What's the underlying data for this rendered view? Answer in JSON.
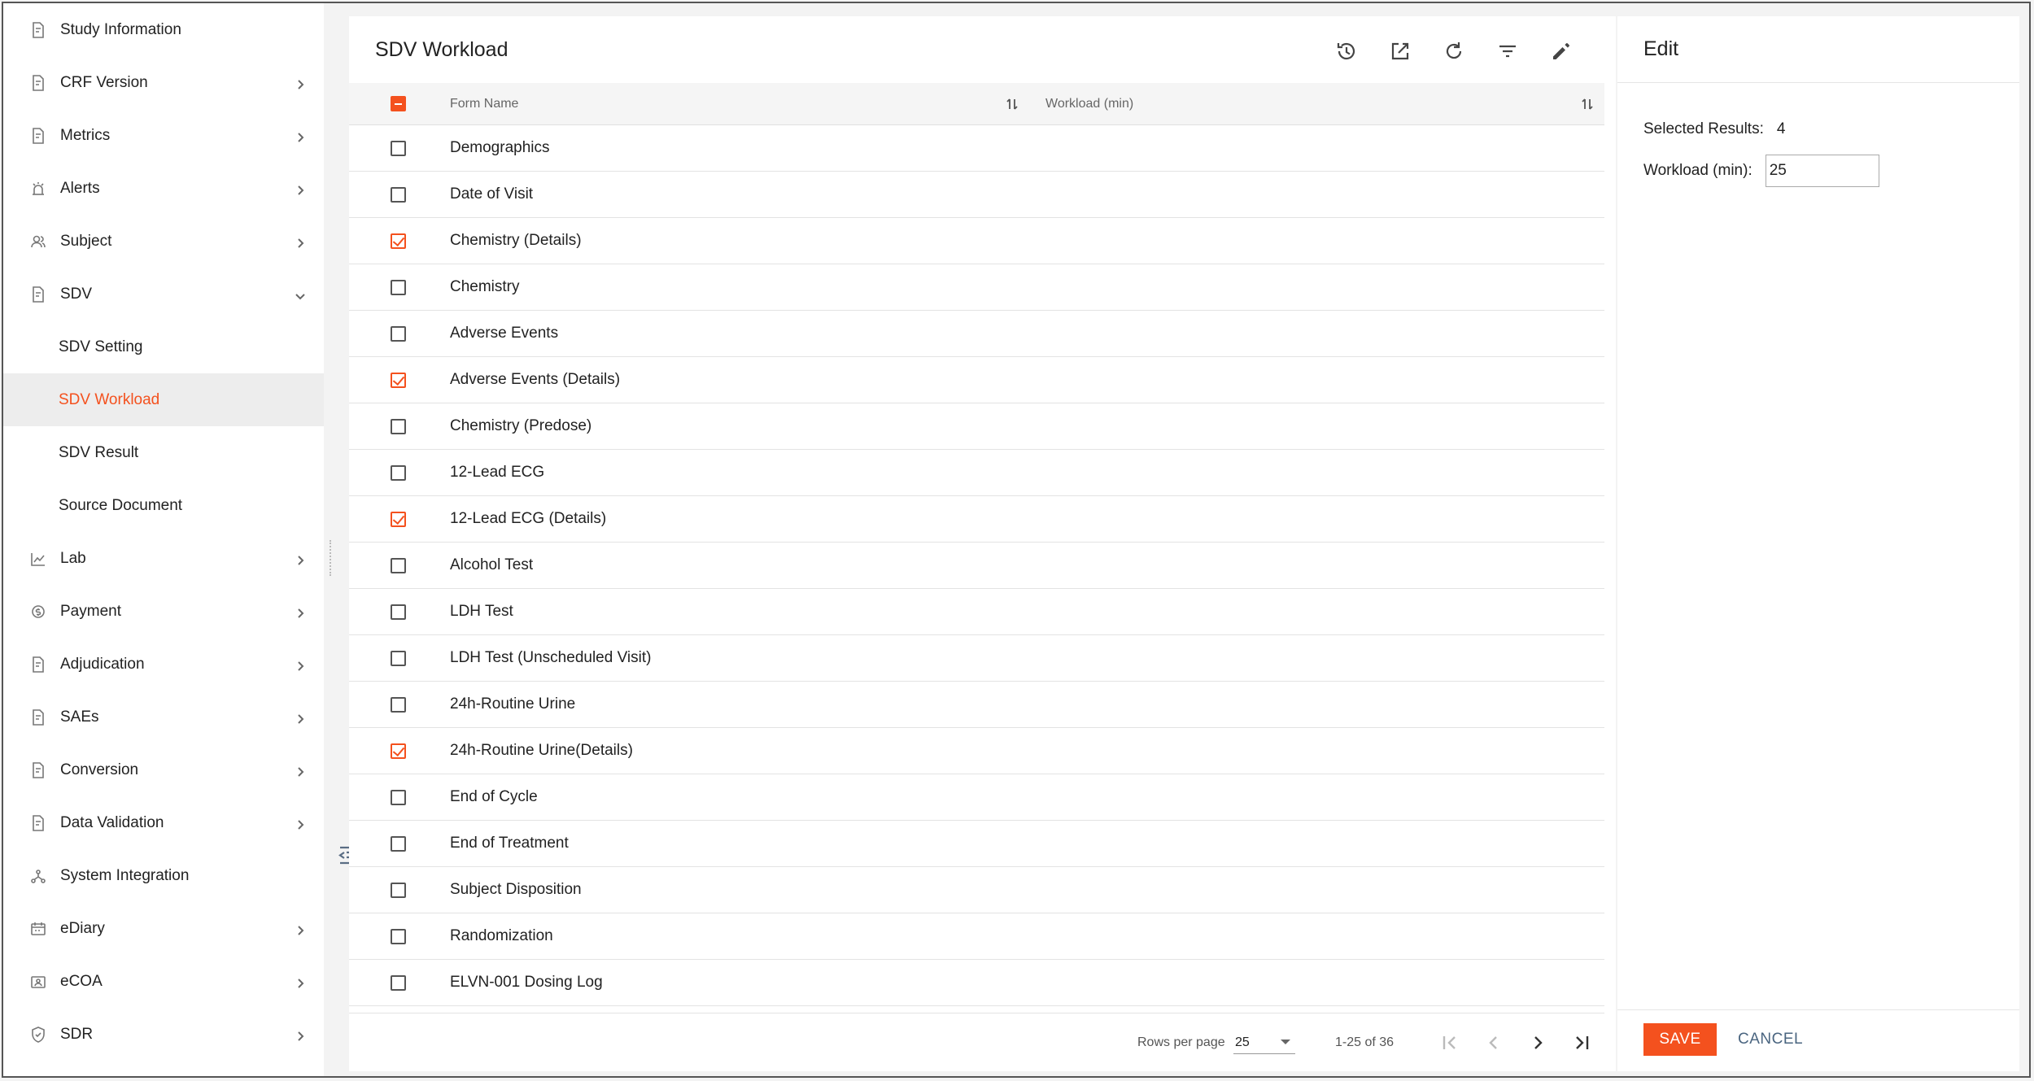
{
  "sidebar": {
    "items": [
      {
        "label": "Study Information",
        "icon": "document-icon",
        "chevron": "none"
      },
      {
        "label": "CRF Version",
        "icon": "document-icon",
        "chevron": "right"
      },
      {
        "label": "Metrics",
        "icon": "document-icon",
        "chevron": "right"
      },
      {
        "label": "Alerts",
        "icon": "alarm-icon",
        "chevron": "right"
      },
      {
        "label": "Subject",
        "icon": "people-icon",
        "chevron": "right"
      },
      {
        "label": "SDV",
        "icon": "document-icon",
        "chevron": "down"
      },
      {
        "label": "SDV Setting",
        "sub": true
      },
      {
        "label": "SDV Workload",
        "sub": true,
        "active": true
      },
      {
        "label": "SDV Result",
        "sub": true
      },
      {
        "label": "Source Document",
        "sub": true
      },
      {
        "label": "Lab",
        "icon": "line-chart-icon",
        "chevron": "right"
      },
      {
        "label": "Payment",
        "icon": "payment-icon",
        "chevron": "right"
      },
      {
        "label": "Adjudication",
        "icon": "document-icon",
        "chevron": "right"
      },
      {
        "label": "SAEs",
        "icon": "document-icon",
        "chevron": "right"
      },
      {
        "label": "Conversion",
        "icon": "document-icon",
        "chevron": "right"
      },
      {
        "label": "Data Validation",
        "icon": "document-icon",
        "chevron": "right"
      },
      {
        "label": "System Integration",
        "icon": "network-icon",
        "chevron": "none"
      },
      {
        "label": "eDiary",
        "icon": "calendar-icon",
        "chevron": "right"
      },
      {
        "label": "eCOA",
        "icon": "id-card-icon",
        "chevron": "right"
      },
      {
        "label": "SDR",
        "icon": "shield-icon",
        "chevron": "right"
      }
    ]
  },
  "main": {
    "title": "SDV Workload",
    "toolbar": [
      "history-icon",
      "open-external-icon",
      "refresh-icon",
      "filter-icon",
      "edit-pencil-icon"
    ],
    "columns": {
      "form_name": "Form Name",
      "workload": "Workload (min)"
    },
    "rows": [
      {
        "name": "Demographics",
        "checked": false
      },
      {
        "name": "Date of Visit",
        "checked": false
      },
      {
        "name": "Chemistry (Details)",
        "checked": true
      },
      {
        "name": "Chemistry",
        "checked": false
      },
      {
        "name": "Adverse Events",
        "checked": false
      },
      {
        "name": "Adverse Events (Details)",
        "checked": true
      },
      {
        "name": "Chemistry (Predose)",
        "checked": false
      },
      {
        "name": "12-Lead ECG",
        "checked": false
      },
      {
        "name": "12-Lead ECG (Details)",
        "checked": true
      },
      {
        "name": "Alcohol Test",
        "checked": false
      },
      {
        "name": "LDH Test",
        "checked": false
      },
      {
        "name": "LDH Test (Unscheduled Visit)",
        "checked": false
      },
      {
        "name": "24h-Routine Urine",
        "checked": false
      },
      {
        "name": "24h-Routine Urine(Details)",
        "checked": true
      },
      {
        "name": "End of Cycle",
        "checked": false
      },
      {
        "name": "End of Treatment",
        "checked": false
      },
      {
        "name": "Subject Disposition",
        "checked": false
      },
      {
        "name": "Randomization",
        "checked": false
      },
      {
        "name": "ELVN-001 Dosing Log",
        "checked": false
      }
    ],
    "footer": {
      "rows_per_page_label": "Rows per page",
      "rows_per_page_value": "25",
      "page_info": "1-25 of 36"
    }
  },
  "edit": {
    "title": "Edit",
    "selected_label": "Selected Results:",
    "selected_value": "4",
    "workload_label": "Workload (min):",
    "workload_value": "25",
    "save_label": "SAVE",
    "cancel_label": "CANCEL"
  },
  "colors": {
    "accent": "#f4511e",
    "cancel": "#4a6580"
  }
}
